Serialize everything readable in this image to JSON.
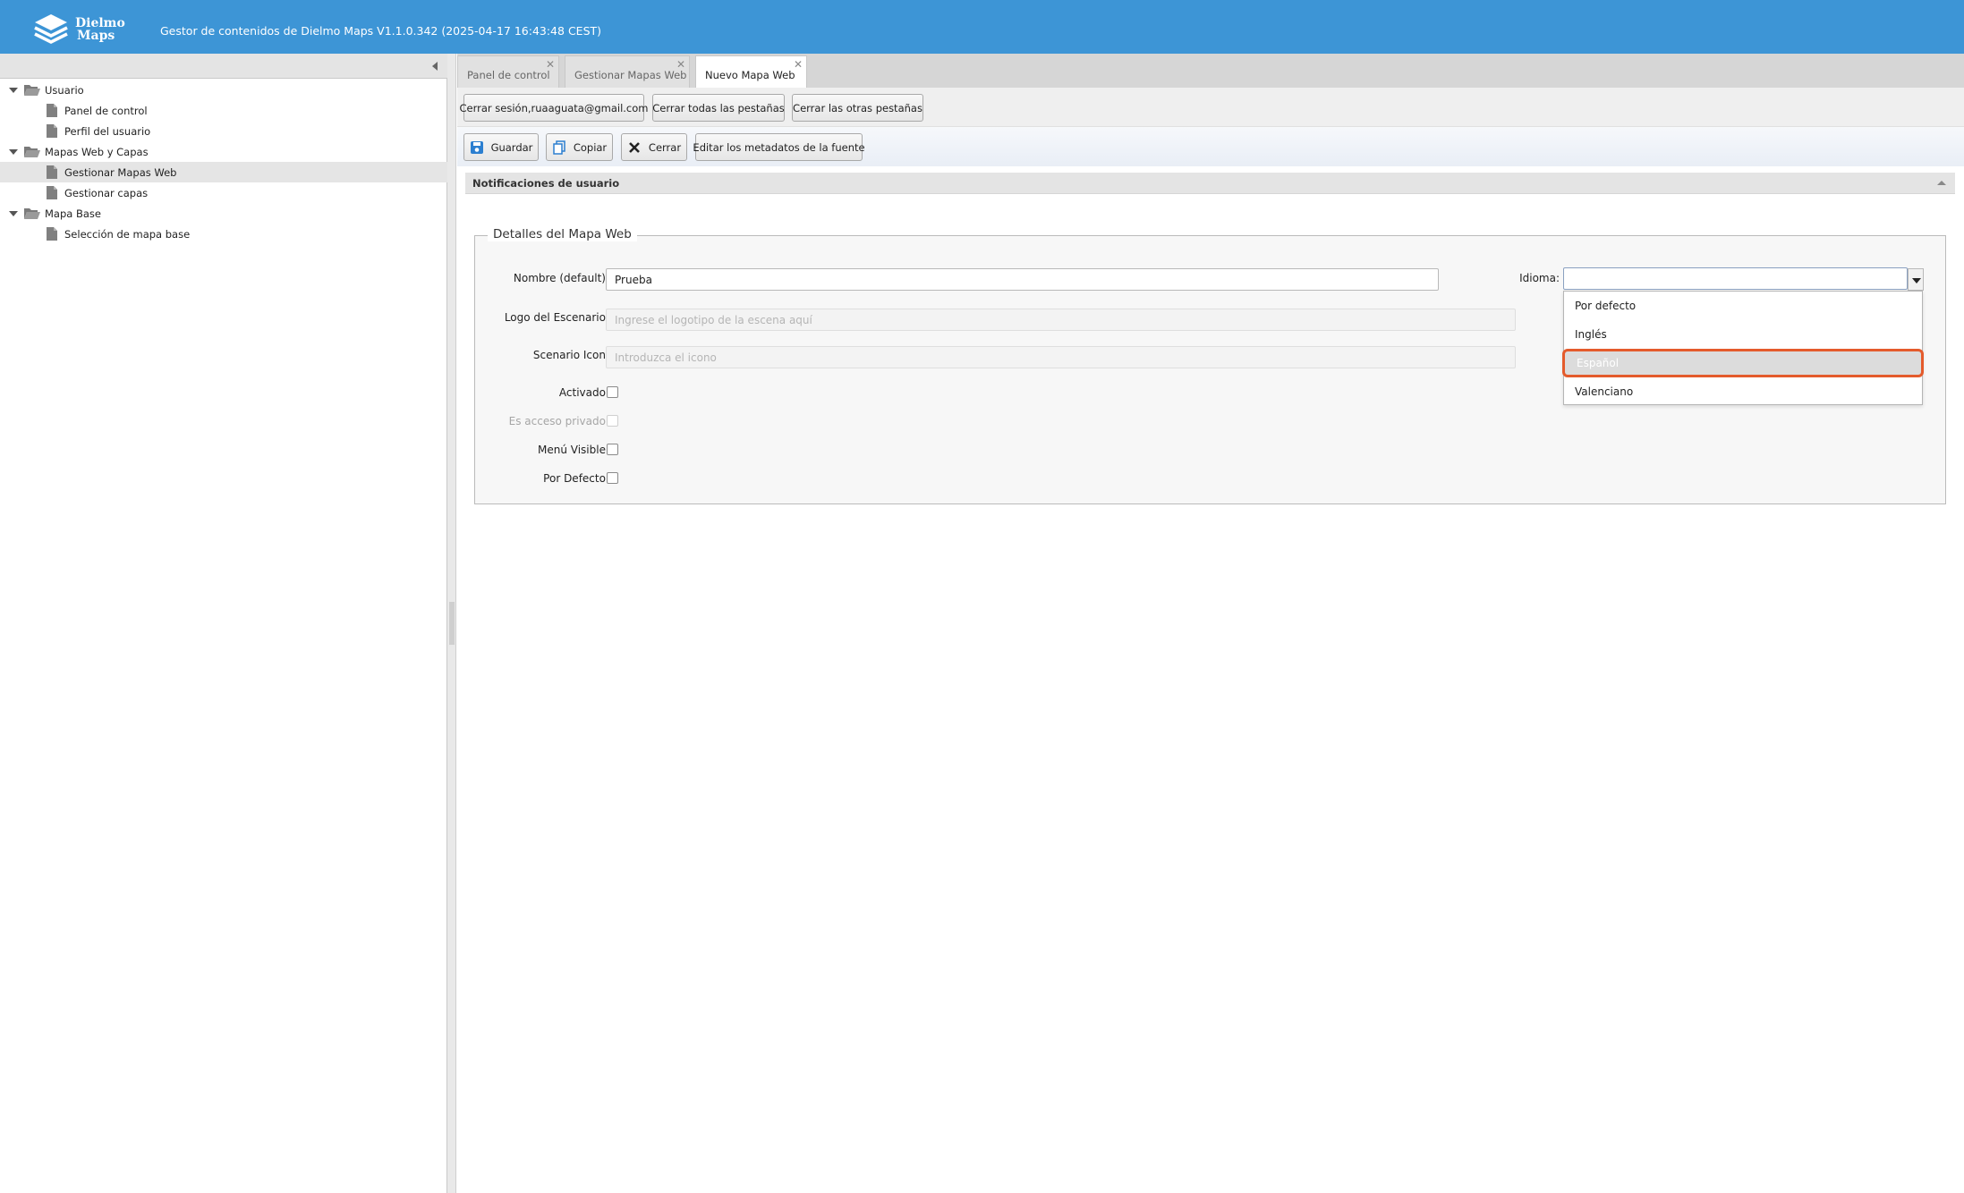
{
  "header": {
    "logo_text_line1": "Dielmo",
    "logo_text_line2": "Maps",
    "app_title": "Gestor de contenidos de Dielmo Maps V1.1.0.342 (2025-04-17 16:43:48 CEST)",
    "background_color": "#3d95d6"
  },
  "tree": {
    "items": [
      {
        "label": "Usuario",
        "type": "folder",
        "icon": "folder-open-icon",
        "expanded": true
      },
      {
        "label": "Panel de control",
        "type": "leaf",
        "icon": "document-icon"
      },
      {
        "label": "Perfil del usuario",
        "type": "leaf",
        "icon": "document-icon"
      },
      {
        "label": "Mapas Web y Capas",
        "type": "folder",
        "icon": "folder-open-icon",
        "expanded": true
      },
      {
        "label": "Gestionar Mapas Web",
        "type": "leaf",
        "icon": "document-icon",
        "selected": true
      },
      {
        "label": "Gestionar capas",
        "type": "leaf",
        "icon": "document-icon"
      },
      {
        "label": "Mapa Base",
        "type": "folder",
        "icon": "folder-open-icon",
        "expanded": true
      },
      {
        "label": "Selección de mapa base",
        "type": "leaf",
        "icon": "document-icon"
      }
    ]
  },
  "tabs": [
    {
      "label": "Panel de control",
      "active": false
    },
    {
      "label": "Gestionar Mapas Web",
      "active": false
    },
    {
      "label": "Nuevo Mapa Web",
      "active": true
    }
  ],
  "session_buttons": {
    "logout": "Cerrar sesión,ruaaguata@gmail.com",
    "close_all": "Cerrar todas las pestañas",
    "close_others": "Cerrar las otras pestañas"
  },
  "toolbar": {
    "save": "Guardar",
    "copy": "Copiar",
    "close": "Cerrar",
    "edit_metadata": "Editar los metadatos de la fuente"
  },
  "notifications": {
    "title": "Notificaciones de usuario"
  },
  "form": {
    "legend": "Detalles del Mapa Web",
    "name_label": "Nombre (default):",
    "name_value": "Prueba",
    "language_label": "Idioma:",
    "language_value": "",
    "logo_label": "Logo del Escenario:",
    "logo_placeholder": "Ingrese el logotipo de la escena aquí",
    "icon_label": "Scenario Icon:",
    "icon_placeholder": "Introduzca el icono",
    "activated_label": "Activado:",
    "activated": false,
    "private_label": "Es acceso privado:",
    "private": false,
    "menu_visible_label": "Menú Visible:",
    "menu_visible": false,
    "default_label": "Por Defecto:",
    "default": false
  },
  "language_dropdown": {
    "options": [
      "Por defecto",
      "Inglés",
      "Español",
      "Valenciano"
    ],
    "highlighted_index": 2,
    "highlight_color": "#e45b2c"
  }
}
